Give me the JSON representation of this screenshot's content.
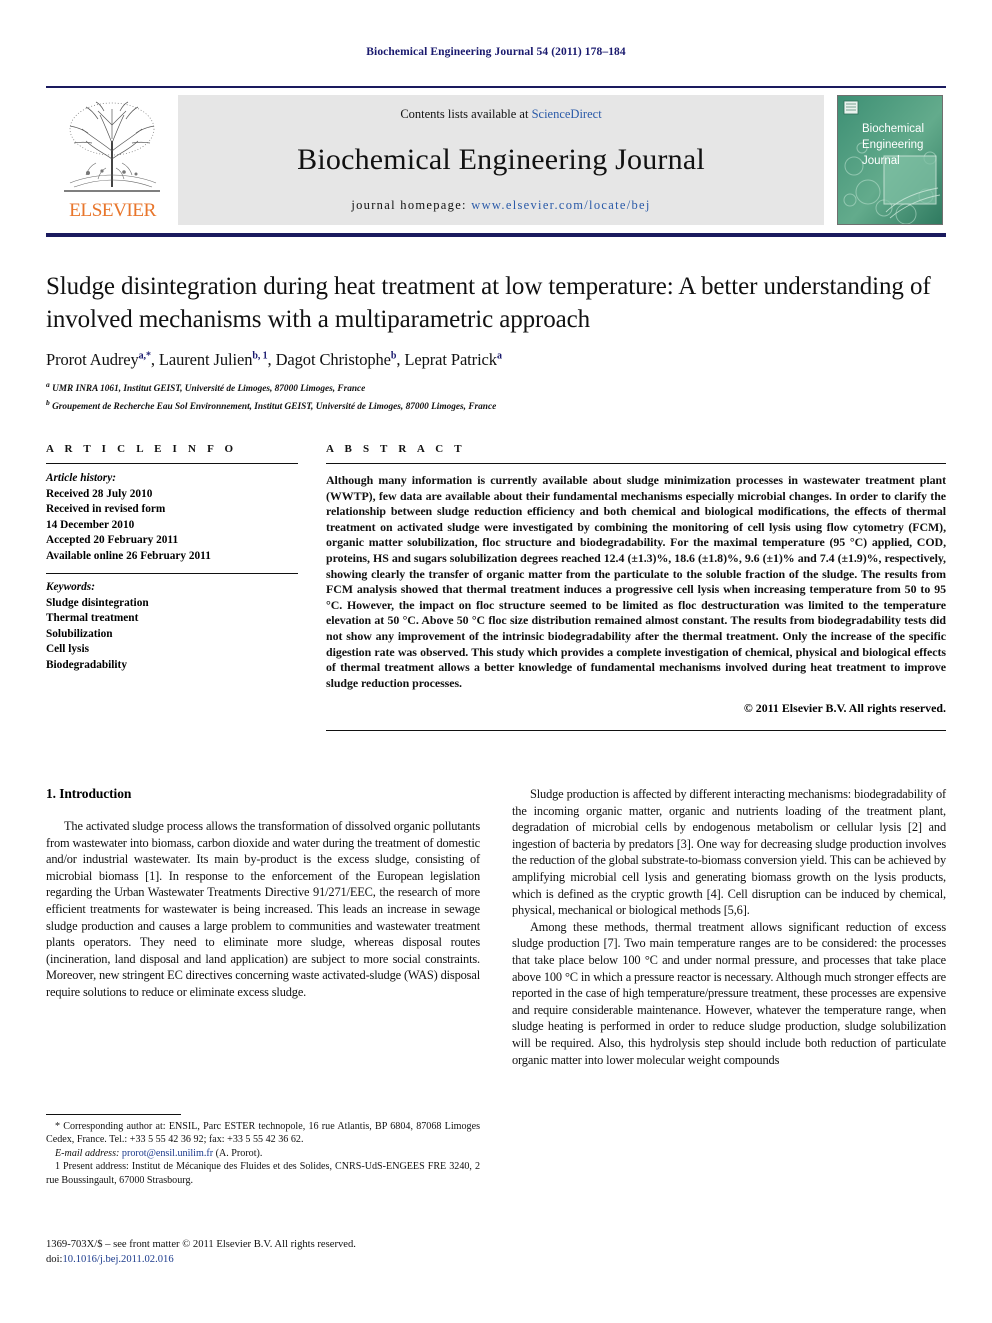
{
  "running_head": "Biochemical Engineering Journal 54 (2011) 178–184",
  "masthead": {
    "contents_prefix": "Contents lists available at ",
    "sciencedirect": "ScienceDirect",
    "journal_name": "Biochemical Engineering Journal",
    "homepage_label": "journal homepage:",
    "homepage_url": "www.elsevier.com/locate/bej",
    "publisher_wordmark": "ELSEVIER",
    "cover_title_lines": [
      "Biochemical",
      "Engineering",
      "Journal"
    ],
    "colors": {
      "rule": "#1a1a5e",
      "band": "#e6e6e6",
      "link": "#2a5aa8",
      "elsevier_orange": "#E8762C",
      "cover_green": "#3e8f72"
    }
  },
  "article": {
    "title": "Sludge disintegration during heat treatment at low temperature: A better understanding of involved mechanisms with a multiparametric approach",
    "authors": [
      {
        "name": "Prorot Audrey",
        "marks": "a,*"
      },
      {
        "name": "Laurent Julien",
        "marks": "b, 1"
      },
      {
        "name": "Dagot Christophe",
        "marks": "b"
      },
      {
        "name": "Leprat Patrick",
        "marks": "a"
      }
    ],
    "affiliations": [
      {
        "mark": "a",
        "text": "UMR INRA 1061, Institut GEIST, Université de Limoges, 87000 Limoges, France"
      },
      {
        "mark": "b",
        "text": "Groupement de Recherche Eau Sol Environnement, Institut GEIST, Université de Limoges, 87000 Limoges, France"
      }
    ]
  },
  "article_info": {
    "heading": "A R T I C L E   I N F O",
    "history_title": "Article history:",
    "history_lines": [
      "Received 28 July 2010",
      "Received in revised form",
      "14 December 2010",
      "Accepted 20 February 2011",
      "Available online 26 February 2011"
    ],
    "keywords_title": "Keywords:",
    "keywords": [
      "Sludge disintegration",
      "Thermal treatment",
      "Solubilization",
      "Cell lysis",
      "Biodegradability"
    ]
  },
  "abstract": {
    "heading": "A B S T R A C T",
    "text": "Although many information is currently available about sludge minimization processes in wastewater treatment plant (WWTP), few data are available about their fundamental mechanisms especially microbial changes. In order to clarify the relationship between sludge reduction efficiency and both chemical and biological modifications, the effects of thermal treatment on activated sludge were investigated by combining the monitoring of cell lysis using flow cytometry (FCM), organic matter solubilization, floc structure and biodegradability. For the maximal temperature (95 °C) applied, COD, proteins, HS and sugars solubilization degrees reached 12.4 (±1.3)%, 18.6 (±1.8)%, 9.6 (±1)% and 7.4 (±1.9)%, respectively, showing clearly the transfer of organic matter from the particulate to the soluble fraction of the sludge. The results from FCM analysis showed that thermal treatment induces a progressive cell lysis when increasing temperature from 50 to 95 °C. However, the impact on floc structure seemed to be limited as floc destructuration was limited to the temperature elevation at 50 °C. Above 50 °C floc size distribution remained almost constant. The results from biodegradability tests did not show any improvement of the intrinsic biodegradability after the thermal treatment. Only the increase of the specific digestion rate was observed. This study which provides a complete investigation of chemical, physical and biological effects of thermal treatment allows a better knowledge of fundamental mechanisms involved during heat treatment to improve sludge reduction processes.",
    "copyright": "© 2011 Elsevier B.V. All rights reserved."
  },
  "body": {
    "section_title": "1.  Introduction",
    "left_paragraphs": [
      "The activated sludge process allows the transformation of dissolved organic pollutants from wastewater into biomass, carbon dioxide and water during the treatment of domestic and/or industrial wastewater. Its main by-product is the excess sludge, consisting of microbial biomass [1]. In response to the enforcement of the European legislation regarding the Urban Wastewater Treatments Directive 91/271/EEC, the research of more efficient treatments for wastewater is being increased. This leads an increase in sewage sludge production and causes a large problem to communities and wastewater treatment plants operators. They need to eliminate more sludge, whereas disposal routes (incineration, land disposal and land application) are subject to more social constraints. Moreover, new stringent EC directives concerning waste activated-sludge (WAS) disposal require solutions to reduce or eliminate excess sludge."
    ],
    "right_paragraphs": [
      "Sludge production is affected by different interacting mechanisms: biodegradability of the incoming organic matter, organic and nutrients loading of the treatment plant, degradation of microbial cells by endogenous metabolism or cellular lysis [2] and ingestion of bacteria by predators [3]. One way for decreasing sludge production involves the reduction of the global substrate-to-biomass conversion yield. This can be achieved by amplifying microbial cell lysis and generating biomass growth on the lysis products, which is defined as the cryptic growth [4]. Cell disruption can be induced by chemical, physical, mechanical or biological methods [5,6].",
      "Among these methods, thermal treatment allows significant reduction of excess sludge production [7]. Two main temperature ranges are to be considered: the processes that take place below 100 °C and under normal pressure, and processes that take place above 100 °C in which a pressure reactor is necessary. Although much stronger effects are reported in the case of high temperature/pressure treatment, these processes are expensive and require considerable maintenance. However, whatever the temperature range, when sludge heating is performed in order to reduce sludge production, sludge solubilization will be required. Also, this hydrolysis step should include both reduction of particulate organic matter into lower molecular weight compounds"
    ]
  },
  "footnotes": {
    "corresponding": "* Corresponding author at: ENSIL, Parc ESTER technopole, 16 rue Atlantis, BP 6804, 87068 Limoges Cedex, France. Tel.: +33 5 55 42 36 92; fax: +33 5 55 42 36 62.",
    "email_label": "E-mail address:",
    "email": "prorot@ensil.unilim.fr",
    "email_suffix": " (A. Prorot).",
    "present_address": "1  Present address: Institut de Mécanique des Fluides et des Solides, CNRS-UdS-ENGEES FRE 3240, 2 rue Boussingault, 67000 Strasbourg."
  },
  "imprint": {
    "line1": "1369-703X/$ – see front matter © 2011 Elsevier B.V. All rights reserved.",
    "doi_label": "doi:",
    "doi_value": "10.1016/j.bej.2011.02.016"
  }
}
